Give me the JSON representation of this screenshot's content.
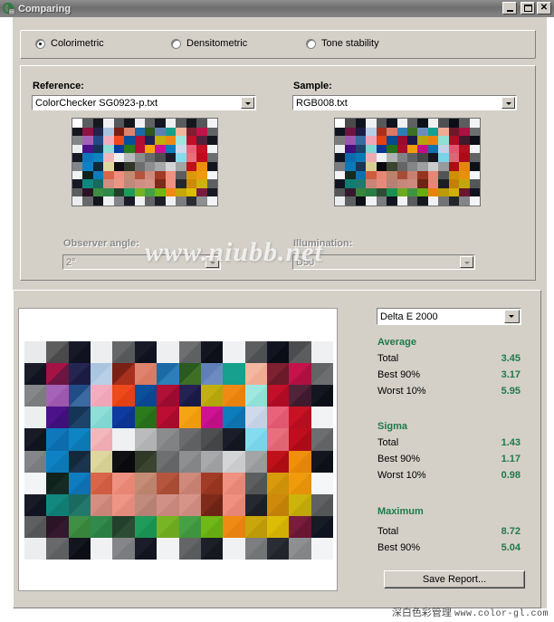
{
  "window": {
    "title": "Comparing",
    "icon": "app-icon",
    "buttons": {
      "minimize": "_",
      "maximize": "□",
      "close": "✕"
    }
  },
  "mode": {
    "options": [
      {
        "label": "Colorimetric",
        "selected": true
      },
      {
        "label": "Densitometric",
        "selected": false
      },
      {
        "label": "Tone stability",
        "selected": false
      }
    ]
  },
  "reference": {
    "label": "Reference:",
    "value": "ColorChecker SG0923-p.txt"
  },
  "sample": {
    "label": "Sample:",
    "value": "RGB008.txt"
  },
  "observer": {
    "label": "Observer angle:",
    "value": "2°",
    "disabled": true
  },
  "illumination": {
    "label": "Illumination:",
    "value": "D50",
    "disabled": true
  },
  "metric": {
    "value": "Delta E 2000"
  },
  "stats": {
    "groups": [
      {
        "title": "Average",
        "rows": [
          {
            "key": "Total",
            "value": "3.45"
          },
          {
            "key": "Best 90%",
            "value": "3.17"
          },
          {
            "key": "Worst 10%",
            "value": "5.95"
          }
        ]
      },
      {
        "title": "Sigma",
        "rows": [
          {
            "key": "Total",
            "value": "1.43"
          },
          {
            "key": "Best 90%",
            "value": "1.17"
          },
          {
            "key": "Worst 10%",
            "value": "0.98"
          }
        ]
      },
      {
        "title": "Maximum",
        "rows": [
          {
            "key": "Total",
            "value": "8.72"
          },
          {
            "key": "Best 90%",
            "value": "5.04"
          }
        ]
      }
    ]
  },
  "actions": {
    "save_report": "Save Report..."
  },
  "watermarks": {
    "center": "www.niubb.net",
    "footer_cn": "深白色彩管理",
    "footer_url": "www.color-gl.com"
  },
  "colors": {
    "accent_green": "#1e7a4a",
    "marker": "#e8a13c",
    "face": "#d4d0c8",
    "titlebar": "#6f6f6f"
  },
  "chart_data": {
    "type": "heatmap",
    "title": "",
    "description": "ColorChecker SG patch comparison grid; each cell is split diagonally, upper-left = reference colour, lower-right = sample colour. Orange outlined cells flag the worst delta-E patches.",
    "columns": 14,
    "rows": 10,
    "marked_cells": [
      [
        0,
        11
      ],
      [
        1,
        1
      ],
      [
        1,
        2
      ],
      [
        1,
        4
      ],
      [
        2,
        2
      ],
      [
        2,
        7
      ],
      [
        3,
        1
      ],
      [
        3,
        12
      ],
      [
        5,
        5
      ],
      [
        8,
        2
      ]
    ],
    "cells": [
      [
        [
          "#e9eaec",
          "#e9eaec"
        ],
        [
          "#5d5d5d",
          "#4a4a4a"
        ],
        [
          "#171a26",
          "#10131f"
        ],
        [
          "#eceef0",
          "#eceef0"
        ],
        [
          "#666768",
          "#57585a"
        ],
        [
          "#181b27",
          "#10131f"
        ],
        [
          "#edeff1",
          "#edeff1"
        ],
        [
          "#6e6f70",
          "#5f6062"
        ],
        [
          "#13161f",
          "#0d1018"
        ],
        [
          "#f0f1f3",
          "#f0f1f3"
        ],
        [
          "#5d5e5f",
          "#4f5052"
        ],
        [
          "#12151f",
          "#0b0e17"
        ],
        [
          "#4b4c4e",
          "#5c5d5f"
        ],
        [
          "#eef0f2",
          "#eef0f2"
        ]
      ],
      [
        [
          "#1a1c28",
          "#101320"
        ],
        [
          "#a41246",
          "#6c1540"
        ],
        [
          "#252552",
          "#1b1c44"
        ],
        [
          "#aac5e0",
          "#b9cfe6"
        ],
        [
          "#7b2014",
          "#a8301d"
        ],
        [
          "#e0836e",
          "#d97a63"
        ],
        [
          "#1a6ba6",
          "#2d7fb8"
        ],
        [
          "#2a5a1f",
          "#3e6f25"
        ],
        [
          "#5f7fb6",
          "#6c8cc0"
        ],
        [
          "#16a08d",
          "#16a08d"
        ],
        [
          "#f3b79f",
          "#f0ab93"
        ],
        [
          "#7e2130",
          "#6a1a28"
        ],
        [
          "#c4124a",
          "#b00f42"
        ],
        [
          "#636466",
          "#6d6e70"
        ]
      ],
      [
        [
          "#86878a",
          "#7b7c7e"
        ],
        [
          "#a563b8",
          "#9b58ae"
        ],
        [
          "#204d86",
          "#3a6aa0"
        ],
        [
          "#f2aec0",
          "#f0a5b8"
        ],
        [
          "#ee4a1c",
          "#e24113"
        ],
        [
          "#0a4f9c",
          "#0b4691"
        ],
        [
          "#b00f36",
          "#9a0c2f"
        ],
        [
          "#242252",
          "#1a1a46"
        ],
        [
          "#c1b00d",
          "#b5a50c"
        ],
        [
          "#f08a14",
          "#e8820f"
        ],
        [
          "#9fe8e0",
          "#8fe0d6"
        ],
        [
          "#c20f2a",
          "#ae0c24"
        ],
        [
          "#53233a",
          "#3d1a2c"
        ],
        [
          "#14161f",
          "#0d0f18"
        ]
      ],
      [
        [
          "#eceef0",
          "#eceef0"
        ],
        [
          "#4c1289",
          "#40107a"
        ],
        [
          "#153456",
          "#1d4468"
        ],
        [
          "#8fded8",
          "#80d6d0"
        ],
        [
          "#0d3ba0",
          "#0c3492"
        ],
        [
          "#2b7b1d",
          "#266f18"
        ],
        [
          "#bc0d33",
          "#a80b2c"
        ],
        [
          "#f5a512",
          "#ee9c0d"
        ],
        [
          "#cf1295",
          "#c00f86"
        ],
        [
          "#0e7dbe",
          "#0d72ae"
        ],
        [
          "#ced9ec",
          "#c3d0e6"
        ],
        [
          "#e8627a",
          "#e05870"
        ],
        [
          "#c81125",
          "#b60e1e"
        ],
        [
          "#f2f3f4",
          "#f2f3f4"
        ]
      ],
      [
        [
          "#181a26",
          "#101320"
        ],
        [
          "#0f78bd",
          "#0d6cad"
        ],
        [
          "#0d84c4",
          "#0c78b4"
        ],
        [
          "#f1b7bc",
          "#eeacb2"
        ],
        [
          "#eef0f2",
          "#eef0f2"
        ],
        [
          "#b9bbbd",
          "#b0b2b4"
        ],
        [
          "#8b8c8e",
          "#818284"
        ],
        [
          "#6a6b6d",
          "#5f6062"
        ],
        [
          "#4e4f51",
          "#444547"
        ],
        [
          "#1b1e2a",
          "#13161f"
        ],
        [
          "#85dcee",
          "#78d4e8"
        ],
        [
          "#e8707c",
          "#e06572"
        ],
        [
          "#c00d1e",
          "#ae0b18"
        ],
        [
          "#6d6e70",
          "#626365"
        ]
      ],
      [
        [
          "#85868a",
          "#7b7c80"
        ],
        [
          "#0d83c6",
          "#0c78b6"
        ],
        [
          "#14283c",
          "#1b3450"
        ],
        [
          "#ded8a0",
          "#d6cf93"
        ],
        [
          "#100f13",
          "#0a090d"
        ],
        [
          "#303828",
          "#3a4430"
        ],
        [
          "#6e6f71",
          "#646567"
        ],
        [
          "#8e8f91",
          "#848587"
        ],
        [
          "#a8a9ab",
          "#9e9fa1"
        ],
        [
          "#d4d5d7",
          "#cacbcd"
        ],
        [
          "#a3a4a6",
          "#999a9c"
        ],
        [
          "#c01018",
          "#ac0d13"
        ],
        [
          "#ef8f0a",
          "#e68608"
        ],
        [
          "#14161f",
          "#0e1018"
        ]
      ],
      [
        [
          "#f3f4f5",
          "#f3f4f5"
        ],
        [
          "#10221c",
          "#152a22"
        ],
        [
          "#0e7cc1",
          "#0d71b1"
        ],
        [
          "#d8664a",
          "#cf5c41"
        ],
        [
          "#ef9180",
          "#e88676"
        ],
        [
          "#c58d76",
          "#bb836c"
        ],
        [
          "#b5553e",
          "#a94c36"
        ],
        [
          "#cf8a7c",
          "#c58072"
        ],
        [
          "#a23c26",
          "#96341f"
        ],
        [
          "#ee9180",
          "#e68676"
        ],
        [
          "#5d5e60",
          "#535456"
        ],
        [
          "#d99a0c",
          "#cd9009"
        ],
        [
          "#ef9b0c",
          "#e69209"
        ],
        [
          "#f5f6f7",
          "#f5f6f7"
        ]
      ],
      [
        [
          "#181a26",
          "#101320"
        ],
        [
          "#12897f",
          "#107d73"
        ],
        [
          "#1a6a60",
          "#23786c"
        ],
        [
          "#d48e82",
          "#ca8478"
        ],
        [
          "#ed9686",
          "#e58b7b"
        ],
        [
          "#c08a7d",
          "#b68073"
        ],
        [
          "#d09086",
          "#c6867c"
        ],
        [
          "#d69488",
          "#cc8a7e"
        ],
        [
          "#7e2b1c",
          "#6e2415"
        ],
        [
          "#ef9080",
          "#e78676"
        ],
        [
          "#25282e",
          "#1b1e24"
        ],
        [
          "#cf8a0b",
          "#c38008"
        ],
        [
          "#ccb40a",
          "#c0a808"
        ],
        [
          "#5f6062",
          "#555658"
        ]
      ],
      [
        [
          "#5e5f61",
          "#545557"
        ],
        [
          "#2b1426",
          "#35182e"
        ],
        [
          "#3f8f44",
          "#38843c"
        ],
        [
          "#2f8a4c",
          "#2a7e44"
        ],
        [
          "#23402c",
          "#2c4c34"
        ],
        [
          "#1f9c5c",
          "#1b9053"
        ],
        [
          "#77b524",
          "#6ea81f"
        ],
        [
          "#46a046",
          "#3f943e"
        ],
        [
          "#6fb815",
          "#66ac11"
        ],
        [
          "#ef8a14",
          "#e7810f"
        ],
        [
          "#c9a60a",
          "#bd9a08"
        ],
        [
          "#ddbc08",
          "#d1b006"
        ],
        [
          "#7a1c3e",
          "#681631"
        ],
        [
          "#181a26",
          "#101320"
        ]
      ],
      [
        [
          "#ecedef",
          "#ecedef"
        ],
        [
          "#68696b",
          "#5e5f61"
        ],
        [
          "#14161f",
          "#0c0e16"
        ],
        [
          "#f0f1f3",
          "#f0f1f3"
        ],
        [
          "#85868a",
          "#7b7c80"
        ],
        [
          "#1a1d29",
          "#12151f"
        ],
        [
          "#f1f2f4",
          "#f1f2f4"
        ],
        [
          "#646567",
          "#5a5b5d"
        ],
        [
          "#1d2029",
          "#15181f"
        ],
        [
          "#f0f1f3",
          "#f0f1f3"
        ],
        [
          "#7d7e80",
          "#737476"
        ],
        [
          "#2a2d35",
          "#22252b"
        ],
        [
          "#8e8f91",
          "#848587"
        ],
        [
          "#f3f4f5",
          "#f3f4f5"
        ]
      ]
    ],
    "reference_thumb": [
      [
        "#ffffff",
        "#5c5d5f",
        "#16181f",
        "#f0f0f2",
        "#56575a",
        "#13161f",
        "#f0f0f2",
        "#606163",
        "#14161f",
        "#eeeff1",
        "#5a5b5d",
        "#15171f",
        "#565759",
        "#f2f3f4"
      ],
      [
        "#14161f",
        "#8d1340",
        "#22224d",
        "#a9c3de",
        "#781f13",
        "#df826d",
        "#1a6aa5",
        "#2a581e",
        "#5e7eb5",
        "#15a08c",
        "#f2b69e",
        "#7d2030",
        "#c3114a",
        "#626365"
      ],
      [
        "#85868a",
        "#a462b7",
        "#1f4c85",
        "#f1adbf",
        "#ed491b",
        "#094e9b",
        "#af0e35",
        "#232151",
        "#c0af0c",
        "#ef8913",
        "#9ee7df",
        "#c10e29",
        "#522239",
        "#13151e"
      ],
      [
        "#ebedef",
        "#4b1188",
        "#143355",
        "#8eddd7",
        "#0c3a9f",
        "#2a7a1c",
        "#bb0c32",
        "#f4a411",
        "#ce1194",
        "#0d7cbd",
        "#cdd8eb",
        "#e76179",
        "#c71024",
        "#f1f2f3"
      ],
      [
        "#171925",
        "#0e77bc",
        "#0c83c3",
        "#f0b6bb",
        "#edeff1",
        "#b8babc",
        "#8a8b8d",
        "#696a6c",
        "#4d4e50",
        "#1a1d29",
        "#84dbed",
        "#e76f7b",
        "#bf0c1d",
        "#6c6d6f"
      ],
      [
        "#84858a",
        "#0c82c5",
        "#13273b",
        "#ddd79f",
        "#0f0e12",
        "#2f3727",
        "#6d6e70",
        "#8d8e90",
        "#a7a8aa",
        "#d3d4d6",
        "#a2a3a5",
        "#bf0f17",
        "#ee8e09",
        "#13151e"
      ],
      [
        "#f2f3f4",
        "#0f211b",
        "#0d7bc0",
        "#d76549",
        "#ee9080",
        "#c48c75",
        "#b4543d",
        "#ce897b",
        "#a13b25",
        "#ed907f",
        "#5c5d5f",
        "#d8990b",
        "#ee9a0b",
        "#f4f5f6"
      ],
      [
        "#171925",
        "#11887e",
        "#196960",
        "#d38d81",
        "#ec9585",
        "#bf897c",
        "#cf8f85",
        "#d59387",
        "#7d2a1b",
        "#ee8f7f",
        "#24272d",
        "#ce890a",
        "#cbb309",
        "#5e5f61"
      ],
      [
        "#5d5e60",
        "#2a1325",
        "#3e8e43",
        "#2e894b",
        "#223f2b",
        "#1e9b5b",
        "#76b423",
        "#459f45",
        "#6eb714",
        "#ee8913",
        "#c8a509",
        "#dcbb07",
        "#791b3d",
        "#171925"
      ],
      [
        "#ebecee",
        "#67686a",
        "#13151e",
        "#eff0f2",
        "#84858a",
        "#191c28",
        "#f0f1f3",
        "#636466",
        "#1c1f28",
        "#eff0f2",
        "#7c7d7f",
        "#292c34",
        "#8d8e90",
        "#f2f3f4"
      ]
    ],
    "sample_thumb": [
      [
        "#ffffff",
        "#4a4a4a",
        "#10131f",
        "#f0f0f2",
        "#57585a",
        "#10131f",
        "#f0f0f2",
        "#5f6062",
        "#0d1018",
        "#eeeff1",
        "#4f5052",
        "#0b0e17",
        "#5c5d5f",
        "#f2f3f4"
      ],
      [
        "#101320",
        "#6c1540",
        "#1b1c44",
        "#b9cfe6",
        "#a8301d",
        "#d97a63",
        "#2d7fb8",
        "#3e6f25",
        "#6c8cc0",
        "#16a08d",
        "#f0ab93",
        "#6a1a28",
        "#b00f42",
        "#6d6e70"
      ],
      [
        "#7b7c7e",
        "#9b58ae",
        "#3a6aa0",
        "#f0a5b8",
        "#e24113",
        "#0b4691",
        "#9a0c2f",
        "#1a1a46",
        "#b5a50c",
        "#e8820f",
        "#8fe0d6",
        "#ae0c24",
        "#3d1a2c",
        "#0d0f18"
      ],
      [
        "#eceef0",
        "#40107a",
        "#1d4468",
        "#80d6d0",
        "#0c3492",
        "#266f18",
        "#a80b2c",
        "#ee9c0d",
        "#c00f86",
        "#0d72ae",
        "#c3d0e6",
        "#e05870",
        "#b60e1e",
        "#f2f3f4"
      ],
      [
        "#101320",
        "#0d6cad",
        "#0c78b4",
        "#eeacb2",
        "#eef0f2",
        "#b0b2b4",
        "#818284",
        "#5f6062",
        "#444547",
        "#13161f",
        "#78d4e8",
        "#e06572",
        "#ae0b18",
        "#626365"
      ],
      [
        "#7b7c80",
        "#0c78b6",
        "#1b3450",
        "#d6cf93",
        "#0a090d",
        "#3a4430",
        "#646567",
        "#848587",
        "#9e9fa1",
        "#cacbcd",
        "#999a9c",
        "#ac0d13",
        "#e68608",
        "#0e1018"
      ],
      [
        "#f3f4f5",
        "#152a22",
        "#0d71b1",
        "#cf5c41",
        "#e88676",
        "#bb836c",
        "#a94c36",
        "#c58072",
        "#96341f",
        "#e68676",
        "#535456",
        "#cd9009",
        "#e69209",
        "#f5f6f7"
      ],
      [
        "#101320",
        "#107d73",
        "#23786c",
        "#ca8478",
        "#e58b7b",
        "#b68073",
        "#c6867c",
        "#cc8a7e",
        "#6e2415",
        "#e78676",
        "#1b1e24",
        "#c38008",
        "#c0a808",
        "#555658"
      ],
      [
        "#545557",
        "#35182e",
        "#38843c",
        "#2a7e44",
        "#2c4c34",
        "#1b9053",
        "#6ea81f",
        "#3f943e",
        "#66ac11",
        "#e7810f",
        "#bd9a08",
        "#d1b006",
        "#681631",
        "#101320"
      ],
      [
        "#ecedef",
        "#5e5f61",
        "#0c0e16",
        "#f0f1f3",
        "#7b7c80",
        "#12151f",
        "#f1f2f4",
        "#5a5b5d",
        "#15181f",
        "#f0f1f3",
        "#737476",
        "#22252b",
        "#848587",
        "#f3f4f5"
      ]
    ]
  }
}
